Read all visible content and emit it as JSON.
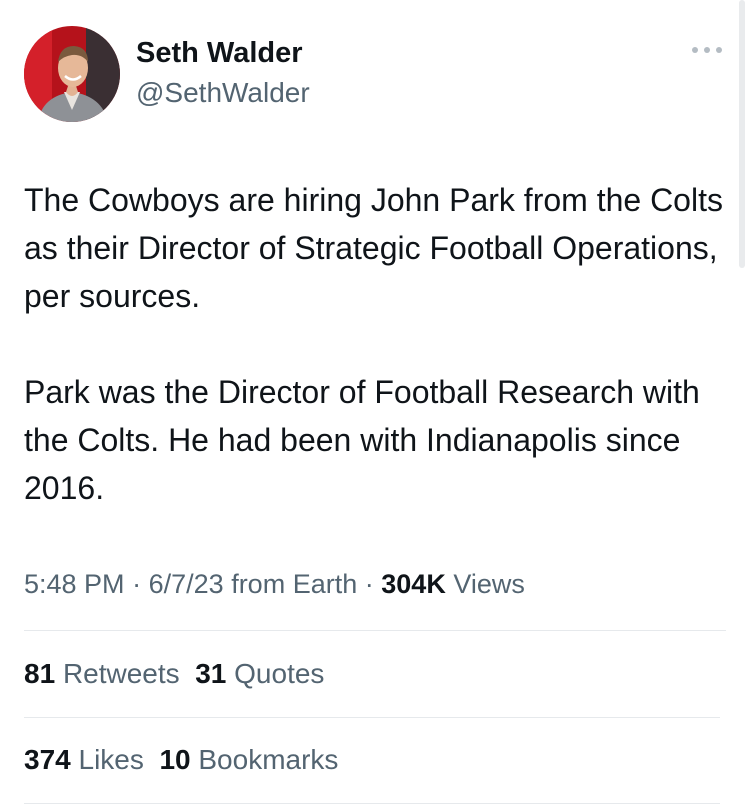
{
  "author": {
    "display_name": "Seth Walder",
    "handle": "@SethWalder"
  },
  "tweet": {
    "paragraphs": [
      "The Cowboys are hiring John Park from the Colts as their Director of Strategic Football Operations, per sources.",
      "Park was the Director of Football Research with the Colts. He had been with Indianapolis since 2016."
    ]
  },
  "meta": {
    "time": "5:48 PM",
    "date": "6/7/23",
    "source": "from Earth",
    "separator": "·",
    "views_count": "304K",
    "views_label": "Views"
  },
  "stats": {
    "retweets_count": "81",
    "retweets_label": "Retweets",
    "quotes_count": "31",
    "quotes_label": "Quotes",
    "likes_count": "374",
    "likes_label": "Likes",
    "bookmarks_count": "10",
    "bookmarks_label": "Bookmarks"
  },
  "icons": {
    "more": "more-options-icon"
  },
  "colors": {
    "primary_text": "#0f1419",
    "secondary_text": "#536471",
    "divider": "#e6e9ec"
  }
}
